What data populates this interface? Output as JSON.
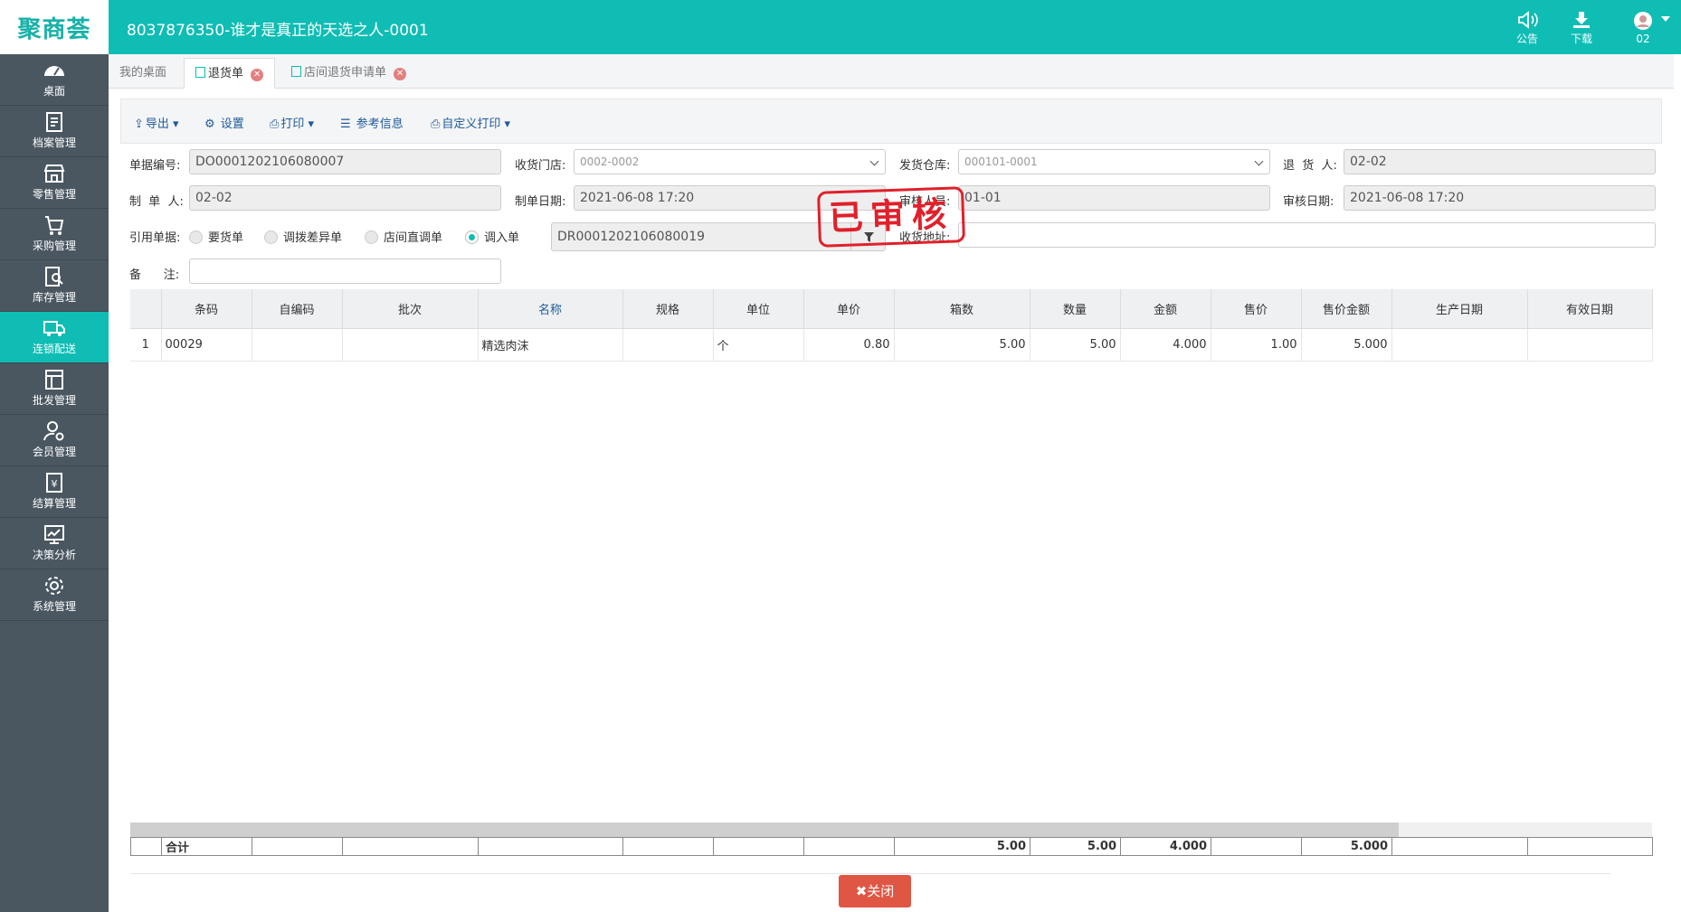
{
  "app": {
    "logo": "聚商荟",
    "title": "8037876350-谁才是真正的天选之人-0001",
    "notice_label": "公告",
    "download_label": "下载",
    "user_label": "02"
  },
  "sidebar": {
    "items": [
      {
        "label": "桌面",
        "icon": "dashboard-icon"
      },
      {
        "label": "档案管理",
        "icon": "archive-icon"
      },
      {
        "label": "零售管理",
        "icon": "store-icon"
      },
      {
        "label": "采购管理",
        "icon": "cart-icon"
      },
      {
        "label": "库存管理",
        "icon": "inventory-icon"
      },
      {
        "label": "连锁配送",
        "icon": "truck-icon"
      },
      {
        "label": "批发管理",
        "icon": "wholesale-icon"
      },
      {
        "label": "会员管理",
        "icon": "member-icon"
      },
      {
        "label": "结算管理",
        "icon": "settlement-icon"
      },
      {
        "label": "决策分析",
        "icon": "chart-icon"
      },
      {
        "label": "系统管理",
        "icon": "gear-icon"
      }
    ]
  },
  "tabs": [
    {
      "label": "我的桌面"
    },
    {
      "label": "退货单"
    },
    {
      "label": "店间退货申请单"
    }
  ],
  "toolbar": {
    "export": "导出",
    "settings": "设置",
    "print": "打印",
    "reference": "参考信息",
    "custom_print": "自定义打印"
  },
  "form": {
    "doc_no_label": "单据编号:",
    "doc_no": "DO0001202106080007",
    "recv_store_label": "收货门店:",
    "recv_store": "0002-0002",
    "send_wh_label": "发货仓库:",
    "send_wh": "000101-0001",
    "returner_label": "退  货  人:",
    "returner": "02-02",
    "maker_label": "制  单  人:",
    "maker": "02-02",
    "make_date_label": "制单日期:",
    "make_date": "2021-06-08 17:20",
    "auditor_label": "审核人员:",
    "auditor": "01-01",
    "audit_date_label": "审核日期:",
    "audit_date": "2021-06-08 17:20",
    "ref_label": "引用单据:",
    "ref_options": [
      "要货单",
      "调拨差异单",
      "店间直调单",
      "调入单"
    ],
    "ref_doc": "DR0001202106080019",
    "address_label": "收货地址:",
    "address": "",
    "remark_label": "备      注:",
    "remark": ""
  },
  "stamp": "已审核",
  "table": {
    "columns": [
      "",
      "条码",
      "自编码",
      "批次",
      "名称",
      "规格",
      "单位",
      "单价",
      "箱数",
      "数量",
      "金额",
      "售价",
      "售价金额",
      "生产日期",
      "有效日期"
    ],
    "rows": [
      [
        "1",
        "00029",
        "",
        "",
        "精选肉沫",
        "",
        "个",
        "0.80",
        "5.00",
        "5.00",
        "4.000",
        "1.00",
        "5.000",
        "",
        ""
      ]
    ],
    "footer": [
      "",
      "合计",
      "",
      "",
      "",
      "",
      "",
      "",
      "5.00",
      "5.00",
      "4.000",
      "",
      "5.000",
      "",
      ""
    ]
  },
  "close_button": "关闭",
  "colors": {
    "brand": "#0fbdb4",
    "sidebar": "#4a5761",
    "link": "#1e5a9c",
    "danger": "#e05644"
  }
}
